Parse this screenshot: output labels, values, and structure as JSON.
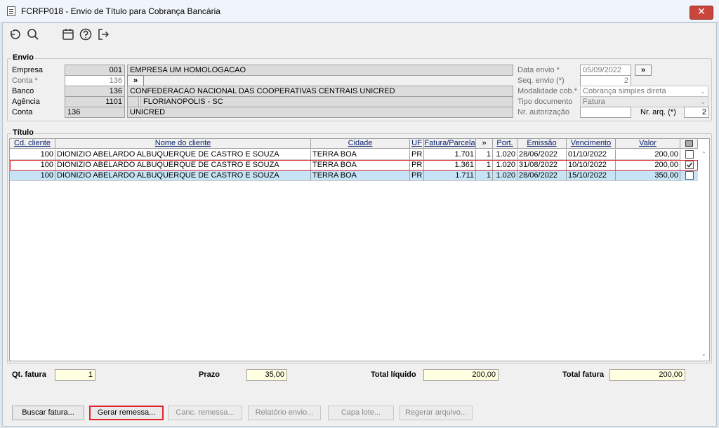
{
  "window": {
    "title": "FCRFP018 - Envio de Título para Cobrança Bancária",
    "close_label": "✕"
  },
  "toolbar": {
    "icons": [
      "undo-icon",
      "search-icon",
      "calendar-icon",
      "help-icon",
      "exit-icon"
    ]
  },
  "envio": {
    "legend": "Envio",
    "empresa": {
      "label": "Empresa",
      "code": "001",
      "name": "EMPRESA UM HOMOLOGACAO"
    },
    "conta_star": {
      "label": "Conta *",
      "value": "136",
      "btn": "»"
    },
    "banco": {
      "label": "Banco",
      "code": "136",
      "name": "CONFEDERACAO NACIONAL DAS COOPERATIVAS CENTRAIS UNICRED"
    },
    "agencia": {
      "label": "Agência",
      "code": "1101",
      "name": "FLORIANOPOLIS - SC"
    },
    "conta": {
      "label": "Conta",
      "code": "136",
      "name": "UNICRED"
    },
    "data_envio": {
      "label": "Data envio *",
      "value": "05/09/2022",
      "btn": "»"
    },
    "seq_envio": {
      "label": "Seq. envio (*)",
      "value": "2"
    },
    "modalidade": {
      "label": "Modalidade cob.*",
      "value": "Cobrança simples direta"
    },
    "tipo_doc": {
      "label": "Tipo documento",
      "value": "Fatura"
    },
    "nr_aut": {
      "label": "Nr. autorização",
      "value": ""
    },
    "nr_arq": {
      "label": "Nr. arq. (*)",
      "value": "2"
    }
  },
  "titulo": {
    "legend": "Título",
    "columns": [
      "Cd. cliente",
      "Nome do cliente",
      "Cidade",
      "UF",
      "Fatura/Parcela",
      "»",
      "Port.",
      "Emissão",
      "Vencimento",
      "Valor"
    ],
    "rows": [
      {
        "cd": "100",
        "nome": "DIONIZIO ABELARDO ALBUQUERQUE DE CASTRO E SOUZA",
        "cidade": "TERRA BOA",
        "uf": "PR",
        "fatura": "1.701",
        "parcela": "1",
        "port": "1.020",
        "emissao": "28/06/2022",
        "vencimento": "01/10/2022",
        "valor": "200,00",
        "checked": false
      },
      {
        "cd": "100",
        "nome": "DIONIZIO ABELARDO ALBUQUERQUE DE CASTRO E SOUZA",
        "cidade": "TERRA BOA",
        "uf": "PR",
        "fatura": "1.361",
        "parcela": "1",
        "port": "1.020",
        "emissao": "31/08/2022",
        "vencimento": "10/10/2022",
        "valor": "200,00",
        "checked": true
      },
      {
        "cd": "100",
        "nome": "DIONIZIO ABELARDO ALBUQUERQUE DE CASTRO E SOUZA",
        "cidade": "TERRA BOA",
        "uf": "PR",
        "fatura": "1.711",
        "parcela": "1",
        "port": "1.020",
        "emissao": "28/06/2022",
        "vencimento": "15/10/2022",
        "valor": "350,00",
        "checked": false
      }
    ]
  },
  "totals": {
    "qt_fatura": {
      "label": "Qt. fatura",
      "value": "1"
    },
    "prazo": {
      "label": "Prazo",
      "value": "35,00"
    },
    "total_liquido": {
      "label": "Total líquido",
      "value": "200,00"
    },
    "total_fatura": {
      "label": "Total fatura",
      "value": "200,00"
    }
  },
  "buttons": {
    "buscar": "Buscar fatura...",
    "gerar": "Gerar remessa...",
    "canc": "Canc. remessa...",
    "relatorio": "Relatório envio...",
    "capa": "Capa lote...",
    "regerar": "Regerar arquivo..."
  },
  "colors": {
    "accent_row": "#c6e4f5",
    "highlight_border": "#e0242b",
    "close_button": "#c9463d",
    "total_field": "#ffffe1"
  }
}
